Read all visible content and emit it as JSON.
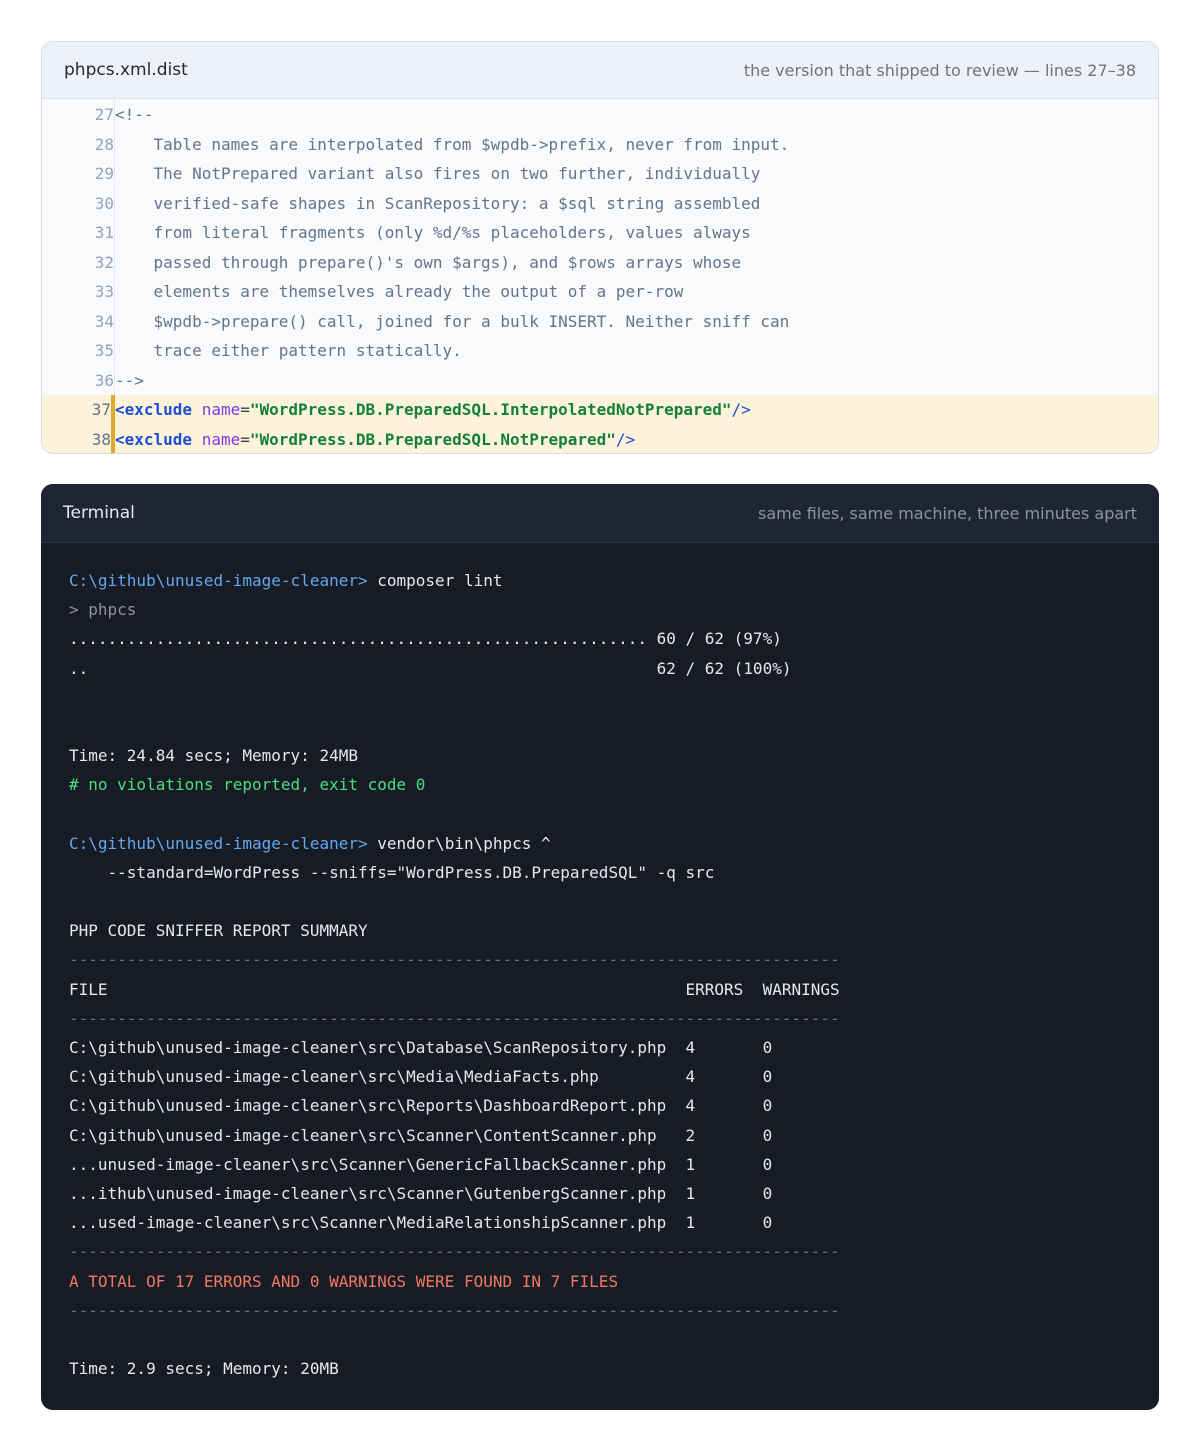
{
  "file_panel": {
    "title": "phpcs.xml.dist",
    "note": "the version that shipped to review — lines 27–38",
    "lines": [
      {
        "num": "27",
        "text": "<!--"
      },
      {
        "num": "28",
        "text": "    Table names are interpolated from $wpdb->prefix, never from input."
      },
      {
        "num": "29",
        "text": "    The NotPrepared variant also fires on two further, individually"
      },
      {
        "num": "30",
        "text": "    verified-safe shapes in ScanRepository: a $sql string assembled"
      },
      {
        "num": "31",
        "text": "    from literal fragments (only %d/%s placeholders, values always"
      },
      {
        "num": "32",
        "text": "    passed through prepare()'s own $args), and $rows arrays whose"
      },
      {
        "num": "33",
        "text": "    elements are themselves already the output of a per-row"
      },
      {
        "num": "34",
        "text": "    $wpdb->prepare() call, joined for a bulk INSERT. Neither sniff can"
      },
      {
        "num": "35",
        "text": "    trace either pattern statically."
      },
      {
        "num": "36",
        "text": "-->"
      }
    ],
    "excludes": [
      {
        "num": "37",
        "open": "<exclude",
        "attr": "name",
        "eq": "=",
        "value": "\"WordPress.DB.PreparedSQL.InterpolatedNotPrepared\"",
        "close": "/>"
      },
      {
        "num": "38",
        "open": "<exclude",
        "attr": "name",
        "eq": "=",
        "value": "\"WordPress.DB.PreparedSQL.NotPrepared\"",
        "close": "/>"
      }
    ]
  },
  "terminal": {
    "title": "Terminal",
    "note": "same files, same machine, three minutes apart",
    "run1": {
      "prompt": "C:\\github\\unused-image-cleaner>",
      "command": " composer lint",
      "subcommand": "> phpcs",
      "progress1": "............................................................ 60 / 62 (97%)",
      "progress2": "..                                                           62 / 62 (100%)",
      "time": "Time: 24.84 secs; Memory: 24MB",
      "result": "# no violations reported, exit code 0"
    },
    "run2": {
      "prompt": "C:\\github\\unused-image-cleaner>",
      "command": " vendor\\bin\\phpcs ^",
      "continuation": "    --standard=WordPress --sniffs=\"WordPress.DB.PreparedSQL\" -q src",
      "report_title": "PHP CODE SNIFFER REPORT SUMMARY",
      "rule": "--------------------------------------------------------------------------------",
      "header_row": "FILE                                                            ERRORS  WARNINGS",
      "rows": [
        "C:\\github\\unused-image-cleaner\\src\\Database\\ScanRepository.php  4       0",
        "C:\\github\\unused-image-cleaner\\src\\Media\\MediaFacts.php         4       0",
        "C:\\github\\unused-image-cleaner\\src\\Reports\\DashboardReport.php  4       0",
        "C:\\github\\unused-image-cleaner\\src\\Scanner\\ContentScanner.php   2       0",
        "...unused-image-cleaner\\src\\Scanner\\GenericFallbackScanner.php  1       0",
        "...ithub\\unused-image-cleaner\\src\\Scanner\\GutenbergScanner.php  1       0",
        "...used-image-cleaner\\src\\Scanner\\MediaRelationshipScanner.php  1       0"
      ],
      "total": "A TOTAL OF 17 ERRORS AND 0 WARNINGS WERE FOUND IN 7 FILES",
      "time": "Time: 2.9 secs; Memory: 20MB"
    }
  },
  "colors": {
    "prompt": "#62a8f0",
    "ok": "#4ade80",
    "error": "#f07860",
    "highlight_bar": "#e0a82e"
  }
}
